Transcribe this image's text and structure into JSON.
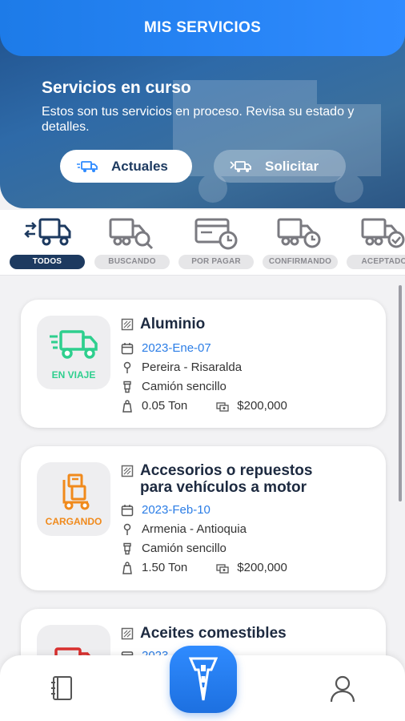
{
  "header": {
    "title": "MIS SERVICIOS"
  },
  "hero": {
    "title": "Servicios en curso",
    "description": "Estos son tus servicios en proceso. Revisa su estado y detalles.",
    "buttons": {
      "actuales": "Actuales",
      "solicitar": "Solicitar"
    }
  },
  "filters": [
    {
      "label": "TODOS",
      "icon": "all-trucks-icon",
      "active": true
    },
    {
      "label": "BUSCANDO",
      "icon": "truck-search-icon"
    },
    {
      "label": "POR PAGAR",
      "icon": "card-clock-icon"
    },
    {
      "label": "CONFIRMANDO",
      "icon": "truck-clock-icon"
    },
    {
      "label": "ACEPTADO",
      "icon": "truck-check-icon"
    }
  ],
  "services": [
    {
      "status": "EN VIAJE",
      "status_color": "#2ecf8e",
      "title": "Aluminio",
      "date": "2023-Ene-07",
      "location": "Pereira - Risaralda",
      "vehicle": "Camión sencillo",
      "weight": "0.05 Ton",
      "price": "$200,000"
    },
    {
      "status": "CARGANDO",
      "status_color": "#f08a1c",
      "title": "Accesorios o repuestos para vehículos a motor",
      "date": "2023-Feb-10",
      "location": "Armenia - Antioquia",
      "vehicle": "Camión sencillo",
      "weight": "1.50 Ton",
      "price": "$200,000"
    },
    {
      "status": "",
      "status_color": "#d9302f",
      "title": "Aceites comestibles",
      "date": "2023",
      "location": "",
      "vehicle": "",
      "weight": "",
      "price": ""
    }
  ],
  "colors": {
    "primary": "#2f8bff",
    "navy": "#1d3a60",
    "date": "#2b7de6"
  }
}
